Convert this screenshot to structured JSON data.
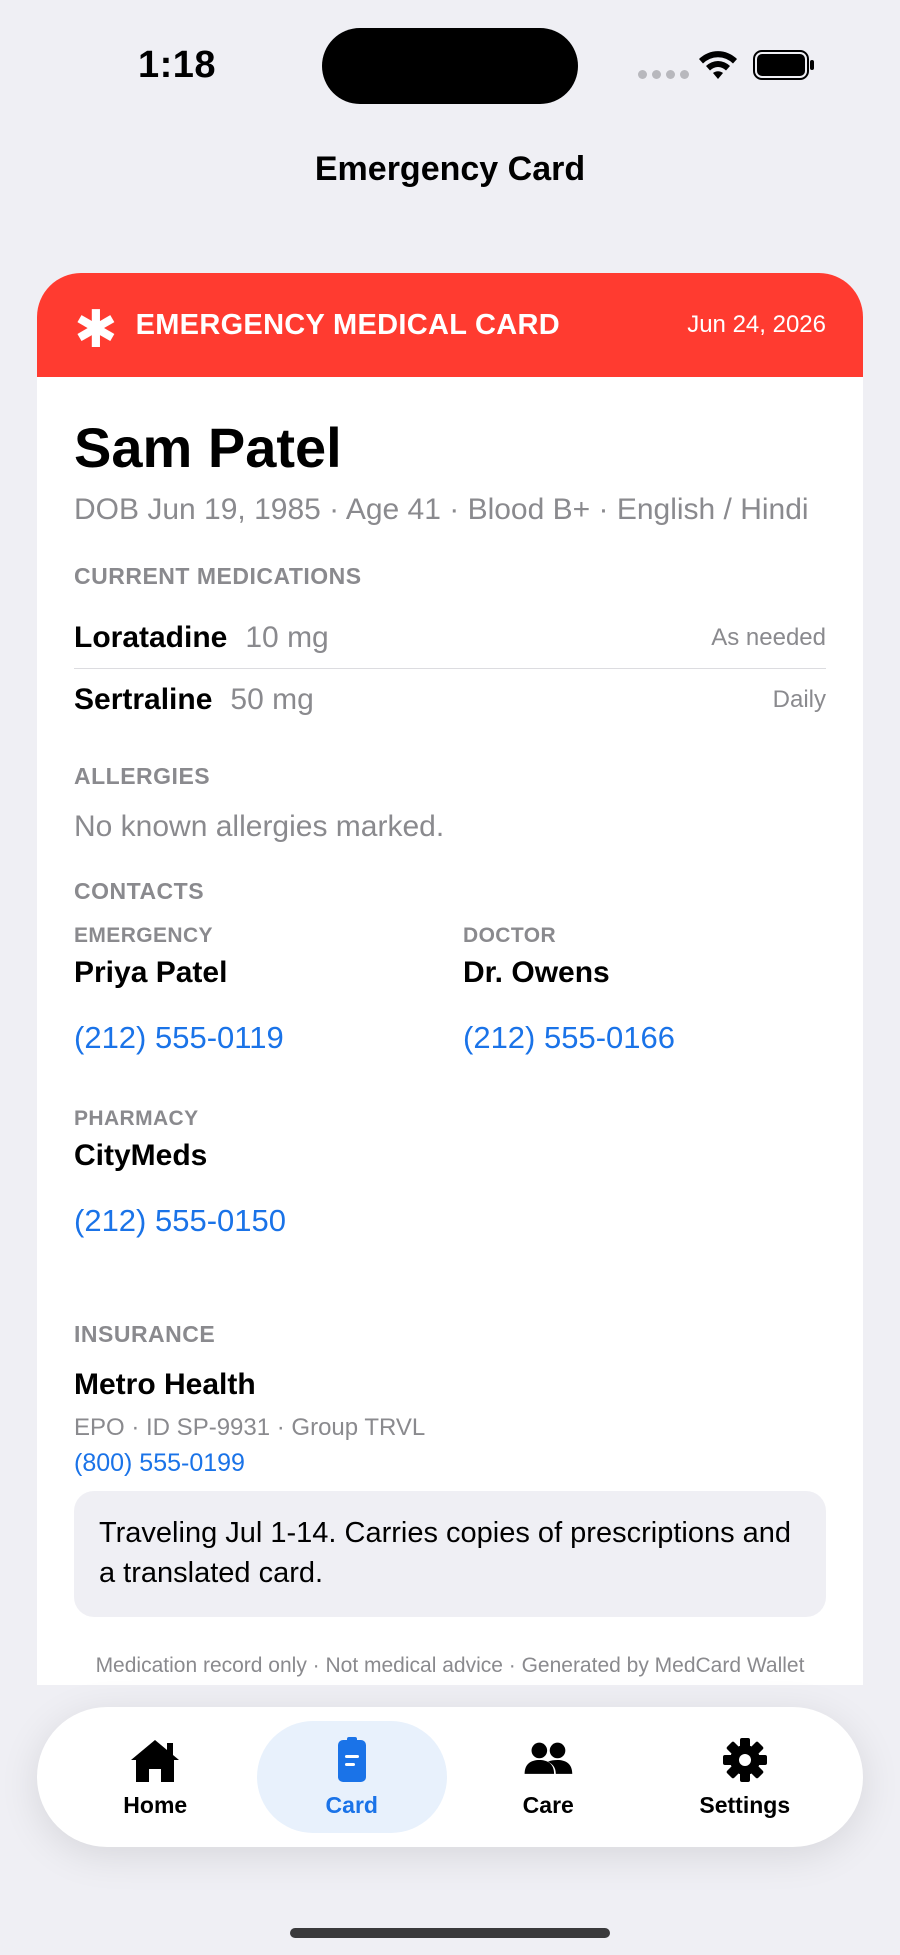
{
  "status_bar": {
    "time": "1:18"
  },
  "nav": {
    "title": "Emergency Card"
  },
  "card": {
    "header_title": "EMERGENCY MEDICAL CARD",
    "header_date": "Jun 24, 2026",
    "header_color": "#ff3b30",
    "name": "Sam Patel",
    "subline": "DOB Jun 19, 1985 · Age 41 · Blood B+ · English / Hindi",
    "medications_label": "CURRENT MEDICATIONS",
    "medications": [
      {
        "name": "Loratadine",
        "dose": "10 mg",
        "frequency": "As needed"
      },
      {
        "name": "Sertraline",
        "dose": "50 mg",
        "frequency": "Daily"
      }
    ],
    "allergies_label": "ALLERGIES",
    "allergies_text": "No known allergies marked.",
    "contacts_label": "CONTACTS",
    "contacts": {
      "emergency": {
        "label": "EMERGENCY",
        "name": "Priya Patel",
        "phone": "(212) 555-0119"
      },
      "doctor": {
        "label": "DOCTOR",
        "name": "Dr. Owens",
        "phone": "(212) 555-0166"
      },
      "pharmacy": {
        "label": "PHARMACY",
        "name": "CityMeds",
        "phone": "(212) 555-0150"
      }
    },
    "insurance_label": "INSURANCE",
    "insurance": {
      "name": "Metro Health",
      "detail": "EPO · ID SP-9931 · Group TRVL",
      "phone": "(800) 555-0199"
    },
    "note": "Traveling Jul 1-14. Carries copies of prescriptions and a translated card.",
    "footer": "Medication record only · Not medical advice · Generated by MedCard Wallet"
  },
  "tabs": [
    {
      "label": "Home",
      "icon": "house-icon",
      "active": false
    },
    {
      "label": "Card",
      "icon": "card-icon",
      "active": true
    },
    {
      "label": "Care",
      "icon": "people-icon",
      "active": false
    },
    {
      "label": "Settings",
      "icon": "gear-icon",
      "active": false
    }
  ],
  "colors": {
    "accent": "#1a73e8",
    "alert": "#ff3b30",
    "background": "#efeff4"
  }
}
